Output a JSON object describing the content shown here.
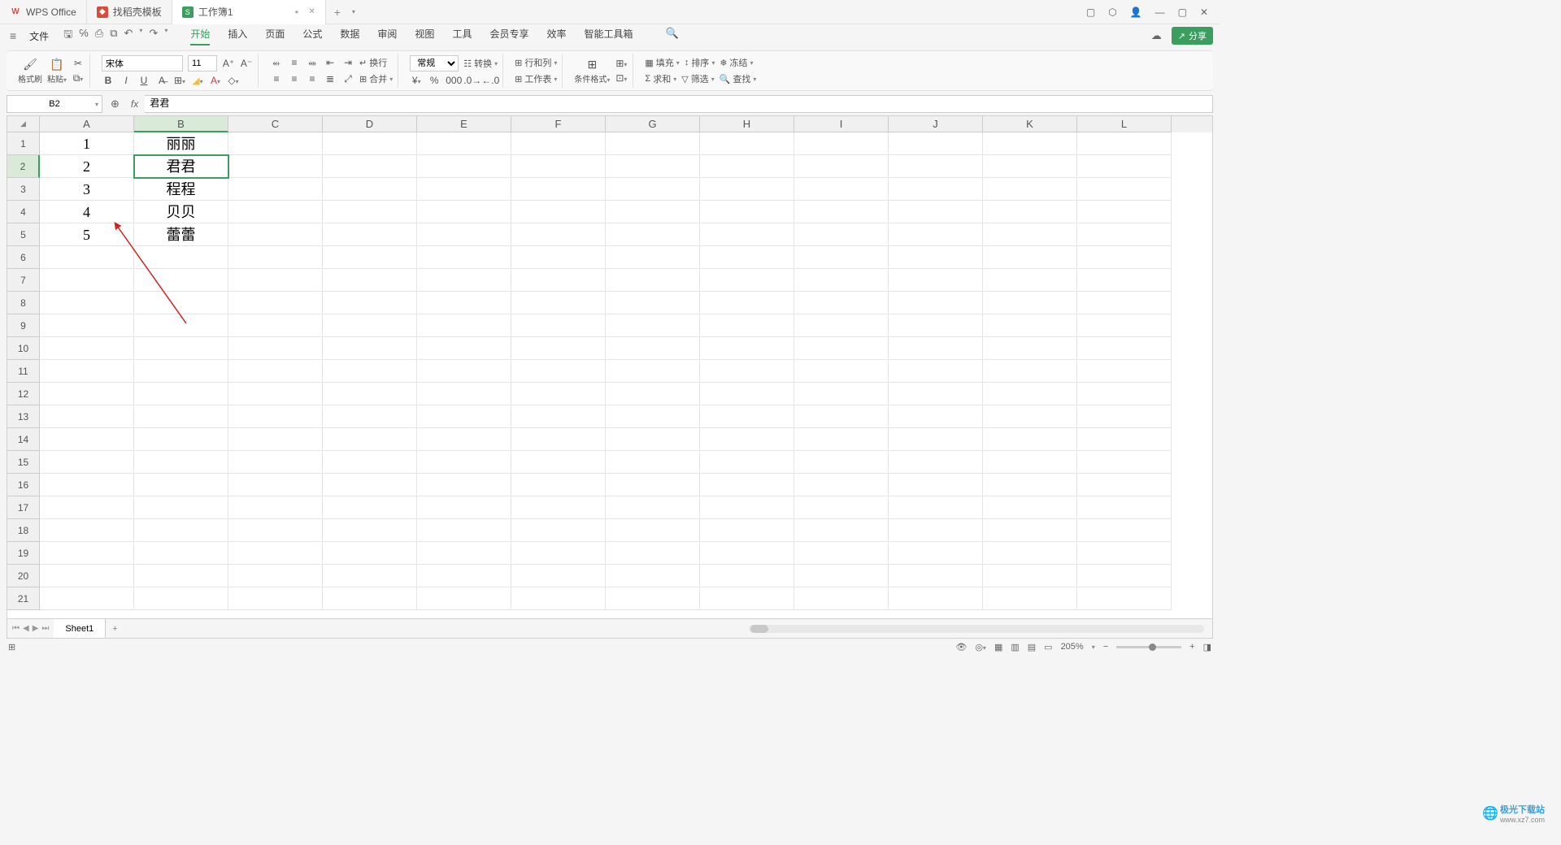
{
  "titlebar": {
    "tabs": [
      {
        "icon": "W",
        "label": "WPS Office"
      },
      {
        "icon": "◆",
        "label": "找稻壳模板"
      },
      {
        "icon": "S",
        "label": "工作簿1",
        "modified": "●"
      }
    ],
    "add": "+"
  },
  "menubar": {
    "file": "文件",
    "tabs": [
      "开始",
      "插入",
      "页面",
      "公式",
      "数据",
      "审阅",
      "视图",
      "工具",
      "会员专享",
      "效率",
      "智能工具箱"
    ],
    "share": "分享"
  },
  "ribbon": {
    "format_painter": "格式刷",
    "paste": "粘贴",
    "font_name": "宋体",
    "font_size": "11",
    "wrap": "换行",
    "merge": "合并",
    "number_format": "常规",
    "convert": "转换",
    "rowcol": "行和列",
    "worksheet": "工作表",
    "cond_format": "条件格式",
    "fill": "填充",
    "sort": "排序",
    "freeze": "冻结",
    "sum": "求和",
    "filter": "筛选",
    "find": "查找"
  },
  "formula_bar": {
    "name_box": "B2",
    "fx": "fx",
    "formula": "君君"
  },
  "grid": {
    "columns": [
      "A",
      "B",
      "C",
      "D",
      "E",
      "F",
      "G",
      "H",
      "I",
      "J",
      "K",
      "L"
    ],
    "row_count": 21,
    "selected_cell": {
      "row": 2,
      "col": "B"
    },
    "data": {
      "A": [
        "1",
        "2",
        "3",
        "4",
        "5"
      ],
      "B": [
        "丽丽",
        "君君",
        "程程",
        "贝贝",
        "蕾蕾"
      ]
    }
  },
  "sheets": {
    "active": "Sheet1"
  },
  "statusbar": {
    "zoom": "205%"
  },
  "watermark": {
    "brand": "极光下载站",
    "url": "www.xz7.com"
  }
}
